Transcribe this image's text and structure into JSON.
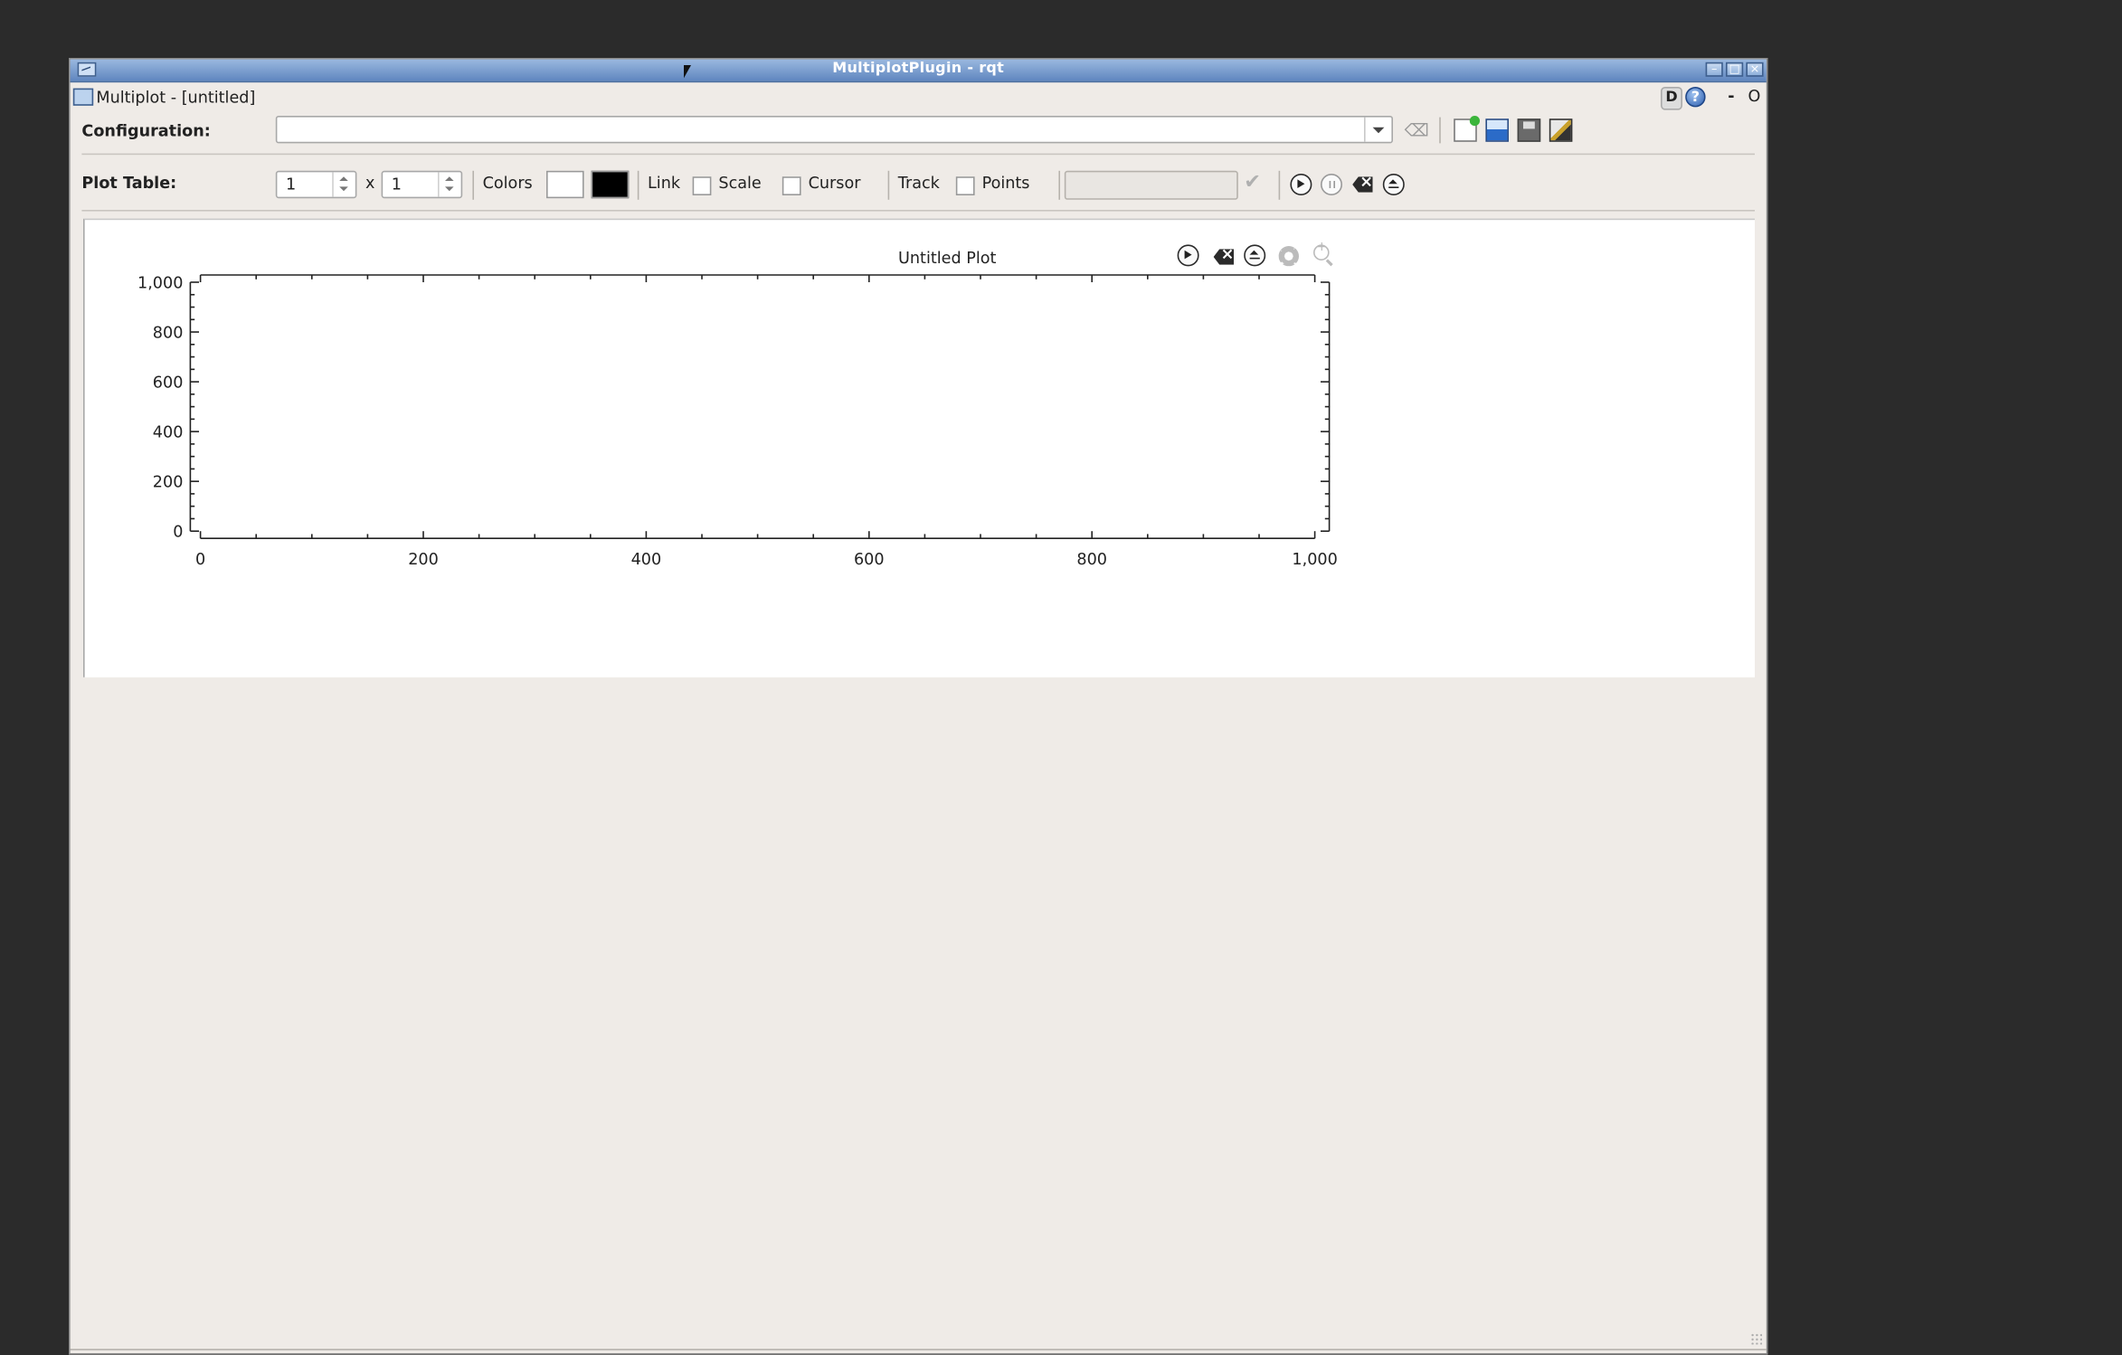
{
  "window": {
    "title": "MultiplotPlugin - rqt"
  },
  "plugin": {
    "title": "Multiplot - [untitled]",
    "d_label": "D",
    "help_label": "?",
    "dash_label": "-",
    "o_label": "O"
  },
  "config": {
    "label": "Configuration:",
    "value": ""
  },
  "plot_table": {
    "label": "Plot Table:",
    "rows": "1",
    "x_label": "x",
    "cols": "1",
    "colors_label": "Colors",
    "background_color": "#ffffff",
    "foreground_color": "#000000",
    "link_label": "Link",
    "scale_label": "Scale",
    "scale_checked": false,
    "cursor_label": "Cursor",
    "cursor_checked": false,
    "track_label": "Track",
    "track_checked": false,
    "points_label": "Points",
    "track_value": ""
  },
  "chart_data": {
    "type": "line",
    "title": "Untitled Plot",
    "xlabel": "",
    "ylabel": "",
    "xlim": [
      0,
      1000
    ],
    "ylim": [
      0,
      1000
    ],
    "x_ticks": [
      "0",
      "200",
      "400",
      "600",
      "800",
      "1,000"
    ],
    "y_ticks": [
      "0",
      "200",
      "400",
      "600",
      "800",
      "1,000"
    ],
    "series": []
  }
}
